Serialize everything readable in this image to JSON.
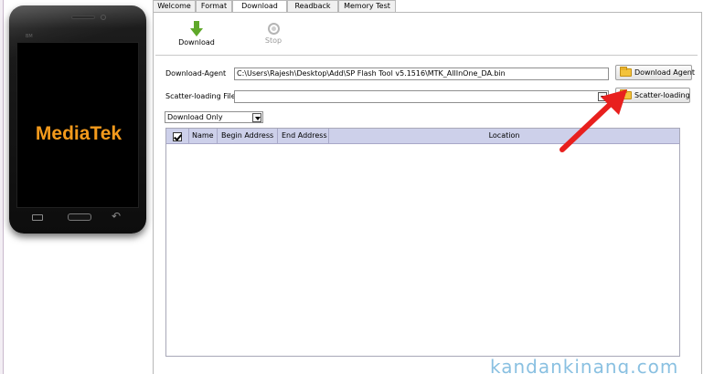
{
  "phone": {
    "brand_text": "BM",
    "logo_text": "MediaTek",
    "logo_color": "#f39a1c"
  },
  "tabs": [
    {
      "label": "Welcome",
      "active": false
    },
    {
      "label": "Format",
      "active": false
    },
    {
      "label": "Download",
      "active": true
    },
    {
      "label": "Readback",
      "active": false
    },
    {
      "label": "Memory Test",
      "active": false
    }
  ],
  "toolbar": {
    "download_label": "Download",
    "download_icon": "download-arrow-icon",
    "stop_label": "Stop",
    "stop_icon": "stop-icon"
  },
  "download_agent": {
    "label": "Download-Agent",
    "value": "C:\\Users\\Rajesh\\Desktop\\Add\\SP Flash Tool v5.1516\\MTK_AllInOne_DA.bin",
    "button_label": "Download Agent"
  },
  "scatter": {
    "label": "Scatter-loading File",
    "value": "",
    "button_label": "Scatter-loading"
  },
  "mode_select": {
    "selected": "Download Only"
  },
  "grid": {
    "columns": [
      "Name",
      "Begin Address",
      "End Address",
      "Location"
    ],
    "header_checkbox_checked": true,
    "header_color": "#cdd0ea"
  },
  "annotation": {
    "arrow_color": "#e8201e"
  },
  "watermark": "kandankinang.com"
}
